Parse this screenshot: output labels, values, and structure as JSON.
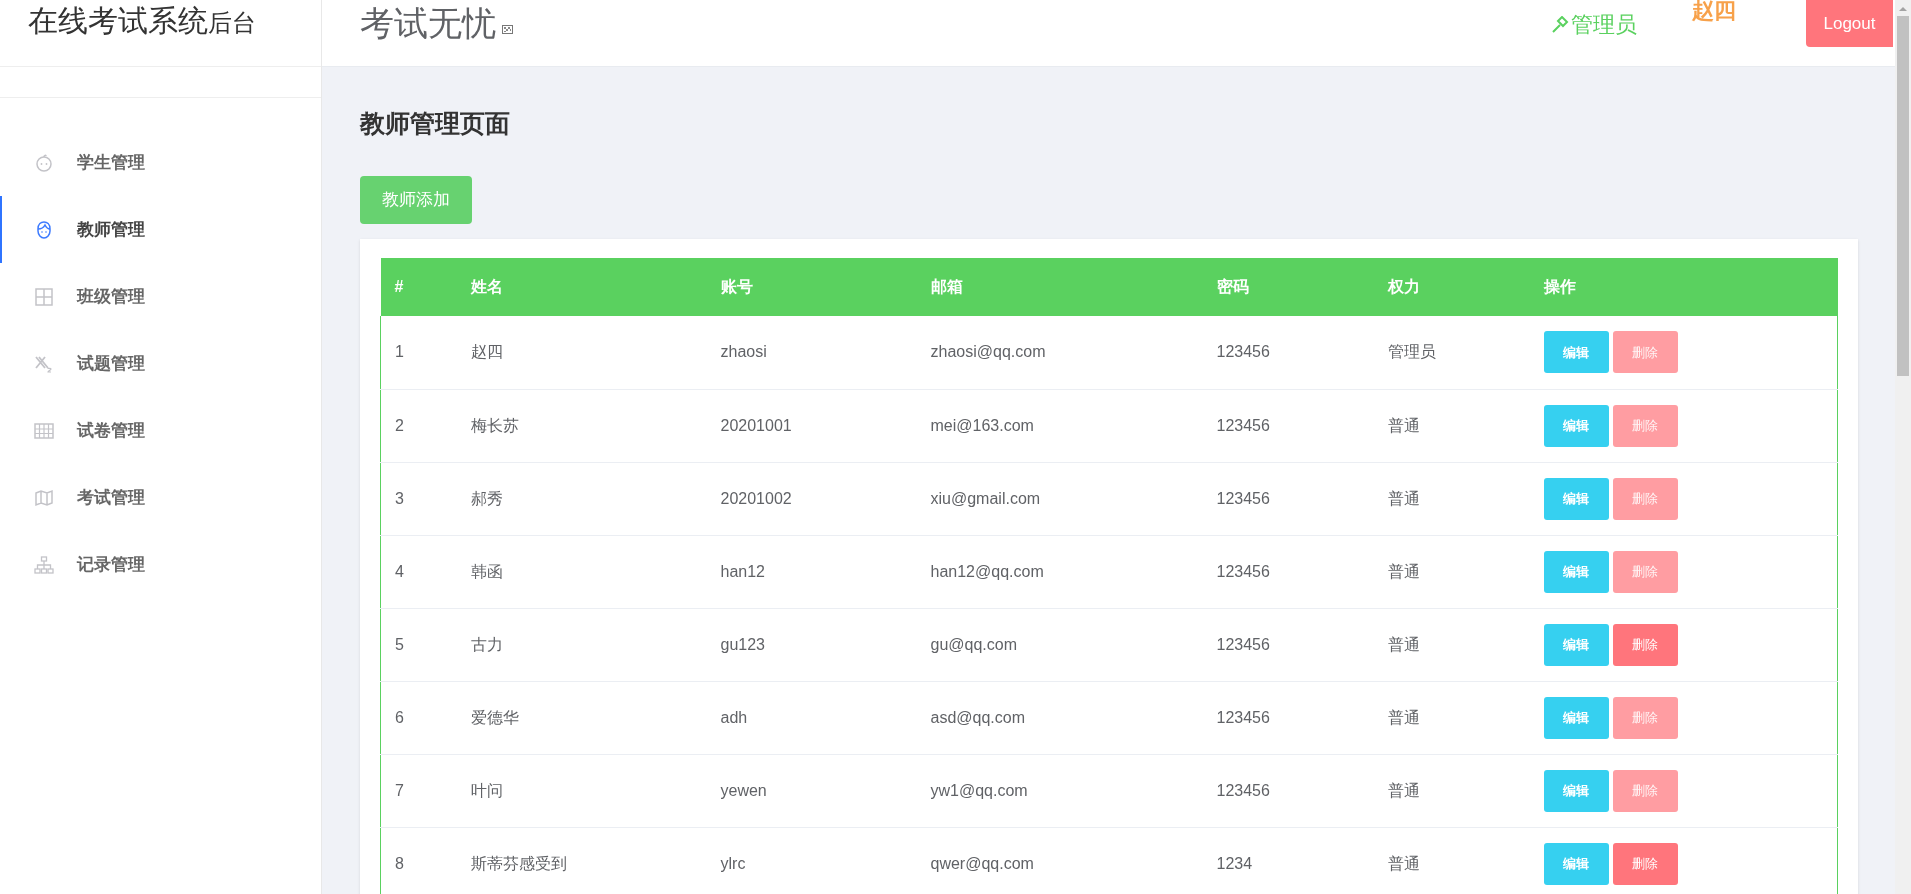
{
  "sidebar": {
    "brand": "在线考试系统",
    "brand_suffix": "后台",
    "items": [
      {
        "label": "学生管理",
        "selected": false
      },
      {
        "label": "教师管理",
        "selected": true
      },
      {
        "label": "班级管理",
        "selected": false
      },
      {
        "label": "试题管理",
        "selected": false
      },
      {
        "label": "试卷管理",
        "selected": false
      },
      {
        "label": "考试管理",
        "selected": false
      },
      {
        "label": "记录管理",
        "selected": false
      }
    ]
  },
  "header": {
    "title": "考试无忧",
    "role": "管理员",
    "user": "赵四",
    "logout": "Logout"
  },
  "page": {
    "title": "教师管理页面",
    "add_button": "教师添加"
  },
  "table": {
    "columns": [
      "#",
      "姓名",
      "账号",
      "邮箱",
      "密码",
      "权力",
      "操作"
    ],
    "rows": [
      {
        "cells": [
          "1",
          "赵四",
          "zhaosi",
          "zhaosi@qq.com",
          "123456",
          "管理员"
        ],
        "edit": "编辑",
        "delete": "删除",
        "delete_disabled": true
      },
      {
        "cells": [
          "2",
          "梅长苏",
          "20201001",
          "mei@163.com",
          "123456",
          "普通"
        ],
        "edit": "编辑",
        "delete": "删除",
        "delete_disabled": true
      },
      {
        "cells": [
          "3",
          "郝秀",
          "20201002",
          "xiu@gmail.com",
          "123456",
          "普通"
        ],
        "edit": "编辑",
        "delete": "删除",
        "delete_disabled": true
      },
      {
        "cells": [
          "4",
          "韩函",
          "han12",
          "han12@qq.com",
          "123456",
          "普通"
        ],
        "edit": "编辑",
        "delete": "删除",
        "delete_disabled": true
      },
      {
        "cells": [
          "5",
          "古力",
          "gu123",
          "gu@qq.com",
          "123456",
          "普通"
        ],
        "edit": "编辑",
        "delete": "删除",
        "delete_disabled": false
      },
      {
        "cells": [
          "6",
          "爱德华",
          "adh",
          "asd@qq.com",
          "123456",
          "普通"
        ],
        "edit": "编辑",
        "delete": "删除",
        "delete_disabled": true
      },
      {
        "cells": [
          "7",
          "叶问",
          "yewen",
          "yw1@qq.com",
          "123456",
          "普通"
        ],
        "edit": "编辑",
        "delete": "删除",
        "delete_disabled": true
      },
      {
        "cells": [
          "8",
          "斯蒂芬感受到",
          "ylrc",
          "qwer@qq.com",
          "1234",
          "普通"
        ],
        "edit": "编辑",
        "delete": "删除",
        "delete_disabled": false
      }
    ]
  }
}
